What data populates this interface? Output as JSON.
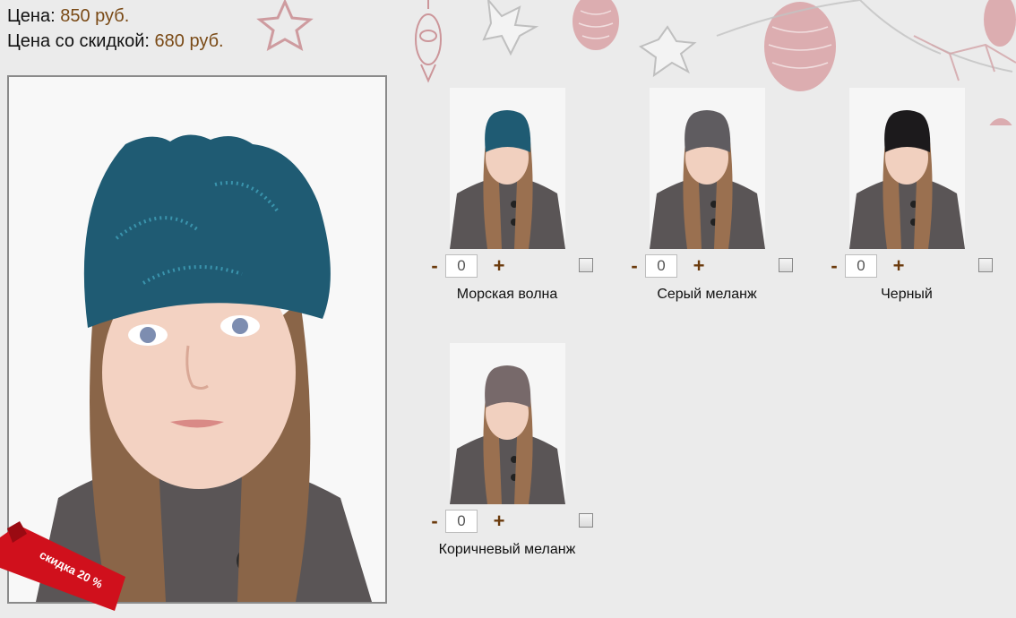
{
  "price": {
    "label": "Цена:",
    "value": "850 руб.",
    "discount_label": "Цена со скидкой:",
    "discount_value": "680 руб."
  },
  "promo": {
    "text": "скидка 20 %",
    "color": "#d0101c"
  },
  "colors": {
    "price_accent": "#7a4a16",
    "qty_sign": "#6b3a0c",
    "background": "#ebebeb"
  },
  "variants": [
    {
      "name": "Морская волна",
      "hat_color": "#1f5b73",
      "qty": "0",
      "checked": false
    },
    {
      "name": "Серый меланж",
      "hat_color": "#5f5c60",
      "qty": "0",
      "checked": false
    },
    {
      "name": "Черный",
      "hat_color": "#1c1a1c",
      "qty": "0",
      "checked": false
    },
    {
      "name": "Коричневый меланж",
      "hat_color": "#77696a",
      "qty": "0",
      "checked": false
    }
  ],
  "qty_controls": {
    "minus": "-",
    "plus": "+"
  }
}
